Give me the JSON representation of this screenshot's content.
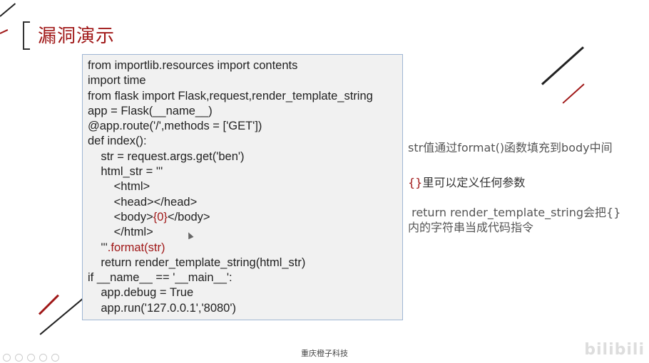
{
  "slide": {
    "title": "漏洞演示",
    "code_lines": [
      {
        "text": "from importlib.resources import contents"
      },
      {
        "text": "import time"
      },
      {
        "text": "from flask import Flask,request,render_template_string"
      },
      {
        "text": "app = Flask(__name__)"
      },
      {
        "text": "@app.route('/',methods = ['GET'])"
      },
      {
        "text": "def index():"
      },
      {
        "text": "    str = request.args.get('ben')"
      },
      {
        "text": "    html_str = '''"
      },
      {
        "text": "        <html>"
      },
      {
        "text": "        <head></head>"
      },
      {
        "pre": "        <body>",
        "red": "{0}",
        "post": "</body>"
      },
      {
        "text": "        </html>"
      },
      {
        "pre": "    '''",
        "red": ".format(str)",
        "post": ""
      },
      {
        "text": "    return render_template_string(html_str)"
      },
      {
        "text": "if __name__ == '__main__':"
      },
      {
        "text": "    app.debug = True"
      },
      {
        "text": "    app.run('127.0.0.1','8080')"
      }
    ],
    "notes": {
      "note1": "str值通过format()函数填充到body中间",
      "note2_brace": "{}",
      "note2_rest": "里可以定义任何参数",
      "note3_line1": " return render_template_string会把{}",
      "note3_line2": "内的字符串当成代码指令"
    },
    "footer": "重庆橙子科技",
    "watermark": "bilibili"
  }
}
